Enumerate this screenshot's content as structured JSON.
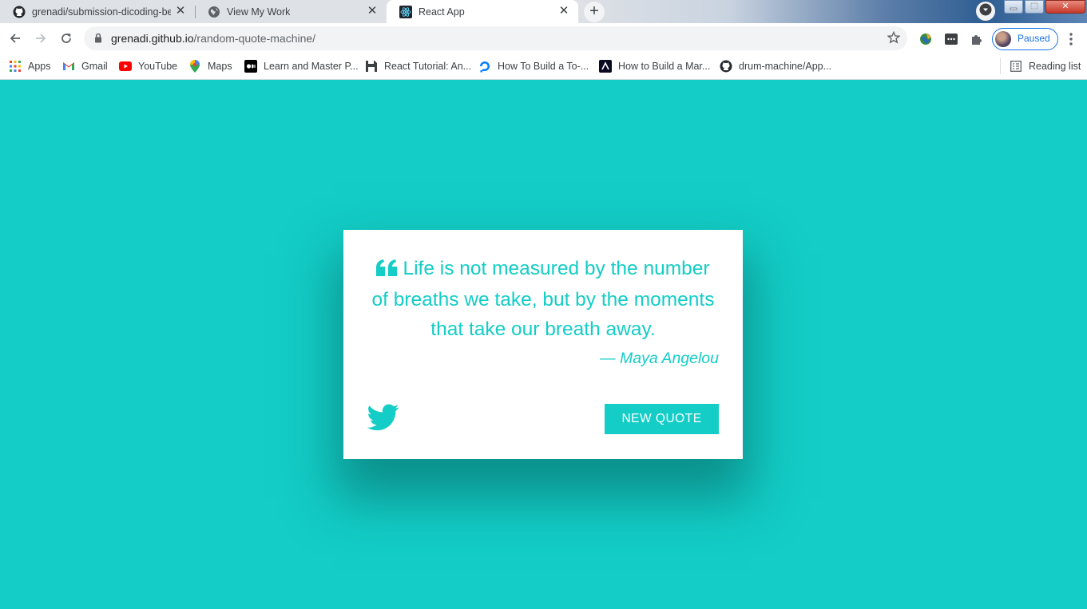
{
  "browser": {
    "tabs": [
      {
        "title": "grenadi/submission-dicoding-be",
        "icon": "github-icon"
      },
      {
        "title": "View My Work",
        "icon": "globe-icon"
      },
      {
        "title": "React App",
        "icon": "react-icon",
        "active": true
      }
    ],
    "url": {
      "host": "grenadi.github.io",
      "path": "/random-quote-machine/"
    },
    "profile_label": "Paused",
    "bookmarks": [
      {
        "label": "Apps",
        "icon": "apps-grid-icon"
      },
      {
        "label": "Gmail",
        "icon": "gmail-icon"
      },
      {
        "label": "YouTube",
        "icon": "youtube-icon"
      },
      {
        "label": "Maps",
        "icon": "maps-icon"
      },
      {
        "label": "Learn and Master P...",
        "icon": "medium-icon"
      },
      {
        "label": "React Tutorial: An...",
        "icon": "floppy-icon"
      },
      {
        "label": "How To Build a To-...",
        "icon": "digitalocean-icon"
      },
      {
        "label": "How to Build a Mar...",
        "icon": "freecodecamp-icon"
      },
      {
        "label": "drum-machine/App...",
        "icon": "github-icon"
      }
    ],
    "reading_list": "Reading list"
  },
  "quote": {
    "text": "Life is not measured by the number of breaths we take, but by the moments that take our breath away.",
    "author": "— Maya Angelou",
    "new_quote_label": "NEW QUOTE"
  },
  "colors": {
    "accent": "#13cdc6",
    "card": "#ffffff"
  }
}
